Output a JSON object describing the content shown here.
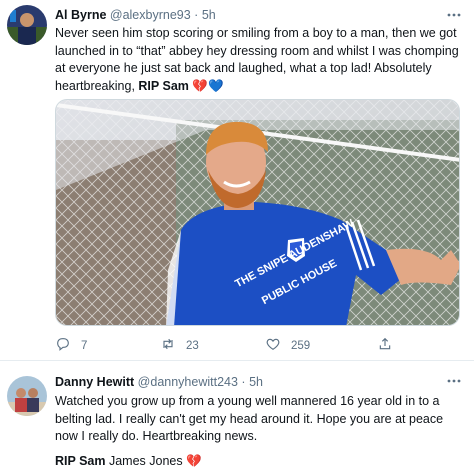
{
  "tweets": [
    {
      "name": "Al Byrne",
      "handle": "@alexbyrne93",
      "separator": "·",
      "time": "5h",
      "text": "Never seen him stop scoring or smiling from a boy to a man, then we got launched in to “that” abbey hey dressing room and whilst I was chomping at everyone he just sat back and laughed, what a top lad! Absolutely heartbreaking,",
      "text_bold": "RIP Sam",
      "emoji": "💔💙",
      "shirt_text_1": "THE SNIPE AUDENSHAW",
      "shirt_text_2": "PUBLIC HOUSE",
      "replies": "7",
      "retweets": "23",
      "likes": "259"
    },
    {
      "name": "Danny Hewitt",
      "handle": "@dannyhewitt243",
      "separator": "·",
      "time": "5h",
      "text": "Watched you grow up from a young well mannered 16 year old in to a belting lad. I really can't get my head around it. Hope you are at peace now I really do. Heartbreaking news.",
      "sig_bold": "RIP Sam",
      "sig_text": " James Jones ",
      "emoji": "💔"
    }
  ],
  "colors": {
    "text": "#0f1419",
    "secondary": "#5b7083",
    "shirt_blue": "#1c4fc4",
    "divider": "#e6ecf0"
  },
  "icons": [
    "reply-icon",
    "retweet-icon",
    "like-icon",
    "share-icon",
    "more-icon"
  ]
}
